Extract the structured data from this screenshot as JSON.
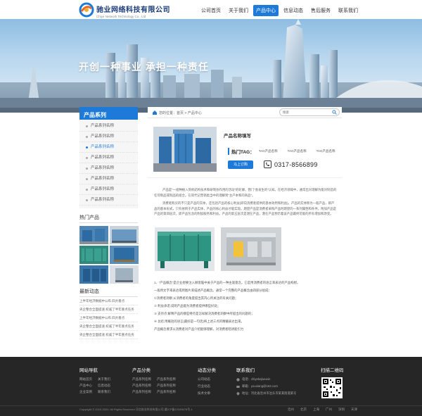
{
  "brand": {
    "name": "驰业网络科技有限公司",
    "english": "Chiye Network Technology Co., Ltd"
  },
  "nav": [
    {
      "label": "公司首页",
      "active": false
    },
    {
      "label": "关于我们",
      "active": false
    },
    {
      "label": "产品中心",
      "active": true
    },
    {
      "label": "信息动态",
      "active": false
    },
    {
      "label": "售后服务",
      "active": false
    },
    {
      "label": "联系我们",
      "active": false
    }
  ],
  "banner": {
    "slogan": "开创一种事业 承担一种责任"
  },
  "sidebar": {
    "title": "产品系列",
    "items": [
      "产品系列名称",
      "产品系列名称",
      "产品系列名称",
      "产品系列名称",
      "产品系列名称",
      "产品系列名称",
      "产品系列名称",
      "产品系列名称"
    ],
    "active_index": 2,
    "hot_title": "热门产品",
    "news_title": "最新动态",
    "news": [
      "上半年经济数据中公布 四大看点",
      "央企整合全面提速 权威了半年重点任务",
      "上半年经济数据中公布 四大看点",
      "央企整合全面提速 权威了半年重点任务",
      "央企整合全面提速 权威了半年重点任务"
    ]
  },
  "main": {
    "breadcrumb": "您的位置：首页 > 产品中心",
    "search_placeholder": "搜索",
    "product_name": "产品名称填写",
    "hot_label": "热门TAG：",
    "tags": [
      "TAG产品名称",
      "TAG产品名称",
      "TAG产品名称"
    ],
    "order_label": "马上订购",
    "phone": "0317-8566899",
    "paragraphs": [
      "产品是“一组种植入到机结构技术和研制协作用的活动”的轮廓。我门“会发生的”认知。在经济领域中，通常出对理解为能对制造的任何制品或制品的组合。在简代记营销类当中的理解到“主产本和的商品”。",
      "消费者购买的不只是产品的实体，还包括产品的核心利益(即向消费者提供的基本效用和利益)。产品的实体称为一般产品，即产品的基本形式，只有依附于产品实体，产品的核心利益才能实现。期望产品是消费者采购产品时期望的一系列属性和条件。附加产品是产品的第四层次，即产品包含的附加服务和利益。产品的第五层次是潜在产品，潜在产品预示着该产品最终可能的所有增加和改变。"
    ],
    "points": [
      "1、“产品概念”是企业想要注入顾客脑中关于产品的一种主观意念，它是用消费者的语言来表达的产品构想。",
      "一般用文字来表达或用图片来描述产品概念。通常一个完整的产品概念由四部分组成：",
      "①消费者洞察:从消费者的角度提出其内心所关注的有关问题；",
      "② 利益承诺:说明产品能为消费者提供哪些好处；",
      "③ 支持点:解释产品的哪些特点是怎样解决消费者洞察中所提出的问题的；",
      "④ 总结:用概括的语言(最好是一句话)将上述三点的精髓表达出来。",
      "产品概念要求以消费者对产品介绍能够理解，对消费者暗诱能引力"
    ]
  },
  "footer": {
    "nav_title": "网站导航",
    "nav_links": [
      "网站首页",
      "关于我们",
      "产品中心",
      "信息动态",
      "企业案例",
      "联系我们"
    ],
    "products_title": "产品分类",
    "product_links": [
      "产品系列名称",
      "产品系列名称",
      "产品系列名称",
      "产品系列名称",
      "产品系列名称",
      "产品系列名称"
    ],
    "news_title": "动态分类",
    "news_links": [
      "公司动态",
      "行业动态",
      "技术文章"
    ],
    "contact_title": "联系我们",
    "contact": [
      "电话：chiyekejiwuxin",
      "邮箱：youxiang@163.com",
      "地址：河北省沧州市泊头市某某街道某号"
    ],
    "qr_title": "扫描二维码",
    "copyright": "Copyright © 2019-2020. All Rights Reserved  河北驰业科技有限公司  冀ICP备12345678号-1",
    "cities": [
      "沧州",
      "北京",
      "上海",
      "广州",
      "深圳",
      "天津"
    ]
  },
  "colors": {
    "accent": "#1d7ad8",
    "footer_bg": "#262626"
  },
  "icons": {
    "home": "home-icon",
    "search": "search-icon",
    "phone": "phone-icon"
  }
}
